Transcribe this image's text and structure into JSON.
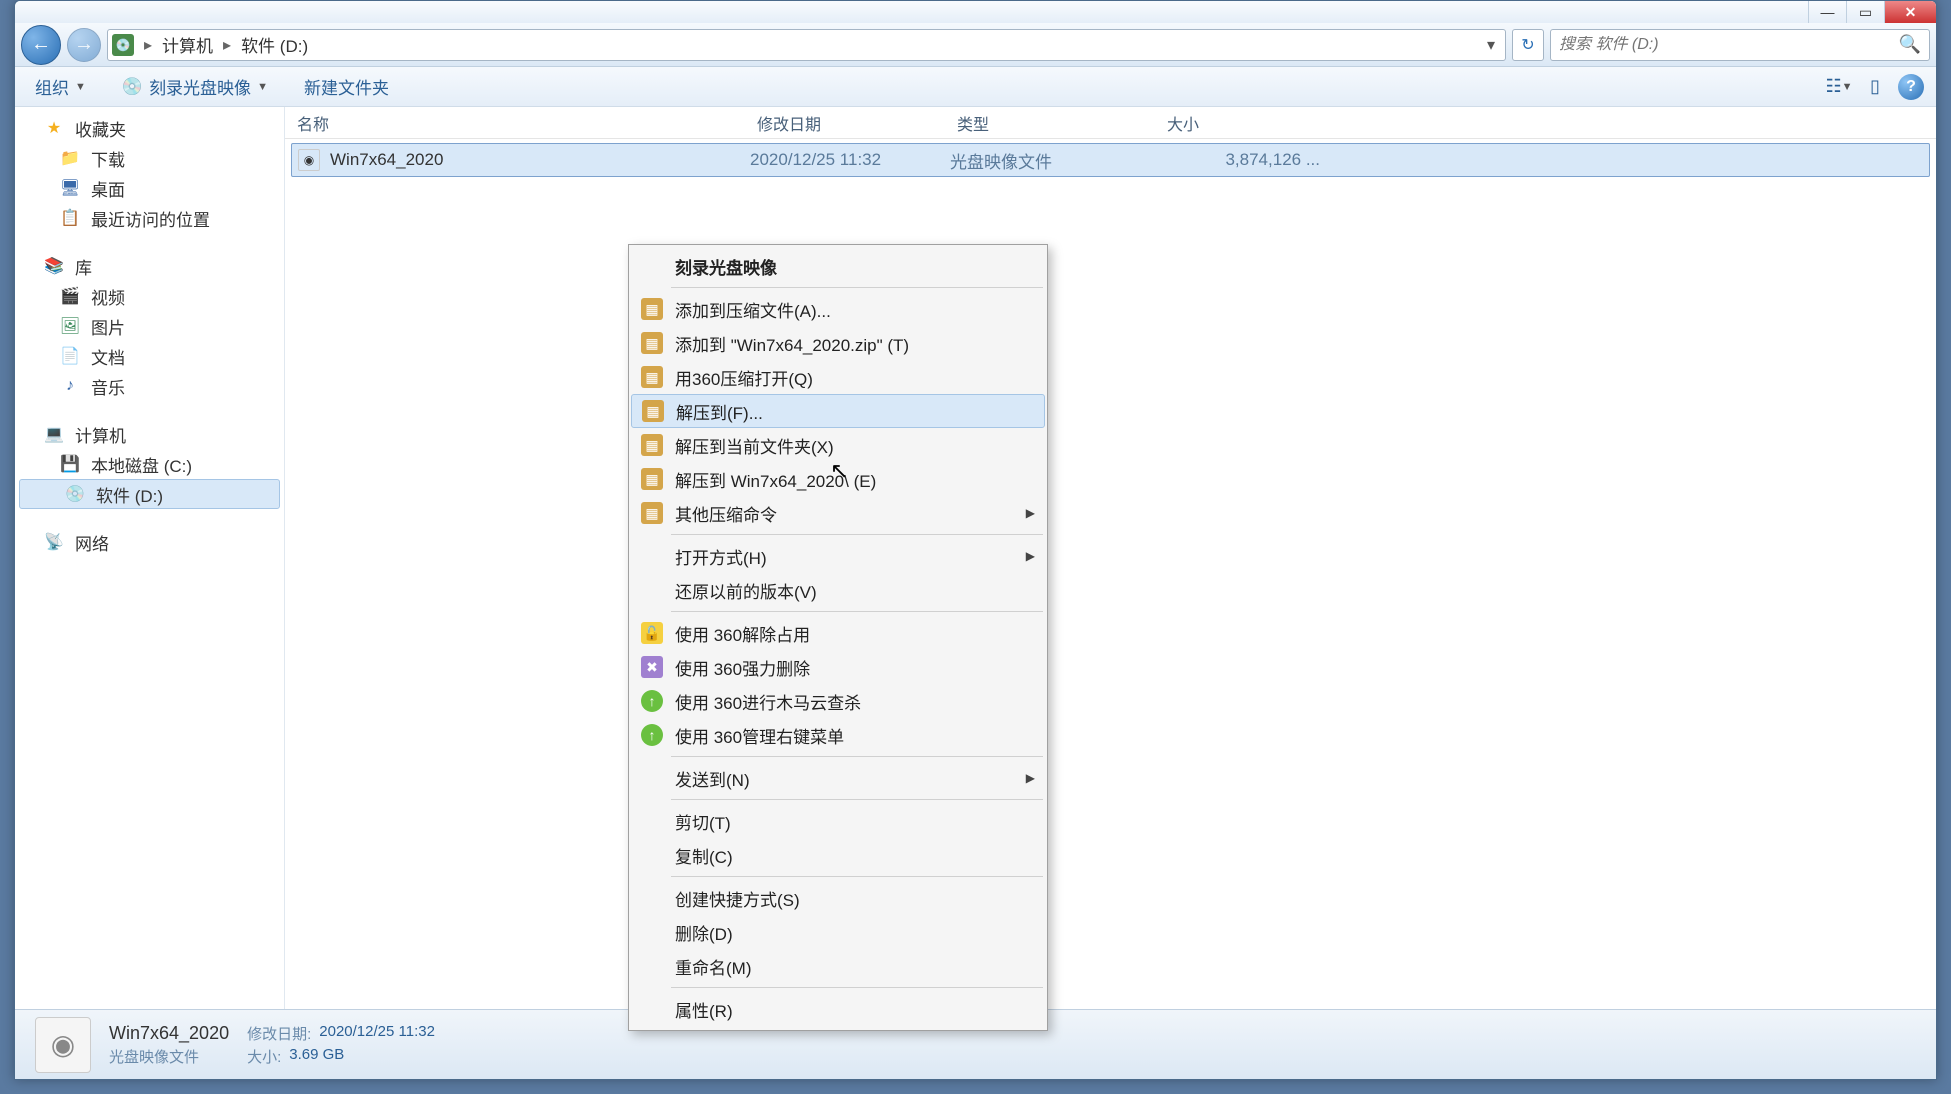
{
  "breadcrumb": {
    "root": "计算机",
    "current": "软件 (D:)"
  },
  "search": {
    "placeholder": "搜索 软件 (D:)"
  },
  "toolbar": {
    "organize": "组织",
    "burn": "刻录光盘映像",
    "newfolder": "新建文件夹"
  },
  "sidebar": {
    "favorites": {
      "header": "收藏夹",
      "downloads": "下载",
      "desktop": "桌面",
      "recent": "最近访问的位置"
    },
    "libraries": {
      "header": "库",
      "videos": "视频",
      "pictures": "图片",
      "documents": "文档",
      "music": "音乐"
    },
    "computer": {
      "header": "计算机",
      "cdrive": "本地磁盘 (C:)",
      "ddrive": "软件 (D:)"
    },
    "network": {
      "header": "网络"
    }
  },
  "columns": {
    "name": "名称",
    "date": "修改日期",
    "type": "类型",
    "size": "大小"
  },
  "file": {
    "name": "Win7x64_2020",
    "date": "2020/12/25 11:32",
    "type": "光盘映像文件",
    "size": "3,874,126 ..."
  },
  "status": {
    "title": "Win7x64_2020",
    "subtitle": "光盘映像文件",
    "date_label": "修改日期:",
    "date_val": "2020/12/25 11:32",
    "size_label": "大小:",
    "size_val": "3.69 GB"
  },
  "ctx": {
    "burn": "刻录光盘映像",
    "addto": "添加到压缩文件(A)...",
    "addtozip": "添加到 \"Win7x64_2020.zip\" (T)",
    "openwith360": "用360压缩打开(Q)",
    "extractto": "解压到(F)...",
    "extracthere": "解压到当前文件夹(X)",
    "extractfolder": "解压到 Win7x64_2020\\ (E)",
    "othercompress": "其他压缩命令",
    "openwith": "打开方式(H)",
    "restore": "还原以前的版本(V)",
    "unlock360": "使用 360解除占用",
    "forcedelete360": "使用 360强力删除",
    "trojanscan360": "使用 360进行木马云查杀",
    "managemenu360": "使用 360管理右键菜单",
    "sendto": "发送到(N)",
    "cut": "剪切(T)",
    "copy": "复制(C)",
    "shortcut": "创建快捷方式(S)",
    "delete": "删除(D)",
    "rename": "重命名(M)",
    "properties": "属性(R)"
  }
}
